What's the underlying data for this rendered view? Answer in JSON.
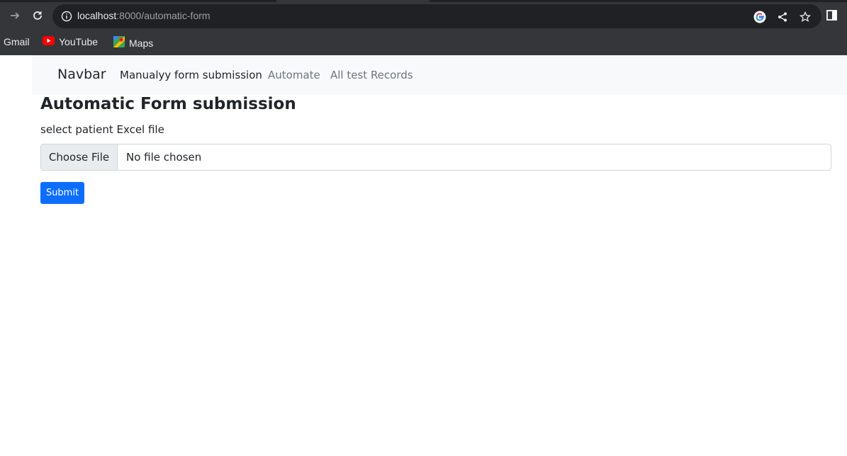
{
  "browser": {
    "url_host": "localhost",
    "url_path": ":8000/automatic-form"
  },
  "bookmarks": [
    {
      "label": "Gmail"
    },
    {
      "label": "YouTube"
    },
    {
      "label": "Maps"
    }
  ],
  "navbar": {
    "brand": "Navbar",
    "links": [
      {
        "label": "Manualyy form submission",
        "active": true
      },
      {
        "label": "Automate",
        "active": false
      },
      {
        "label": "All test Records",
        "active": false
      }
    ]
  },
  "main": {
    "heading": "Automatic Form submission",
    "field_label": "select patient Excel file",
    "file_button": "Choose File",
    "file_status": "No file chosen",
    "submit": "Submit"
  },
  "colors": {
    "primary": "#0d6efd",
    "navbar_bg": "#f8f9fa",
    "chrome_bg": "#35363a"
  }
}
